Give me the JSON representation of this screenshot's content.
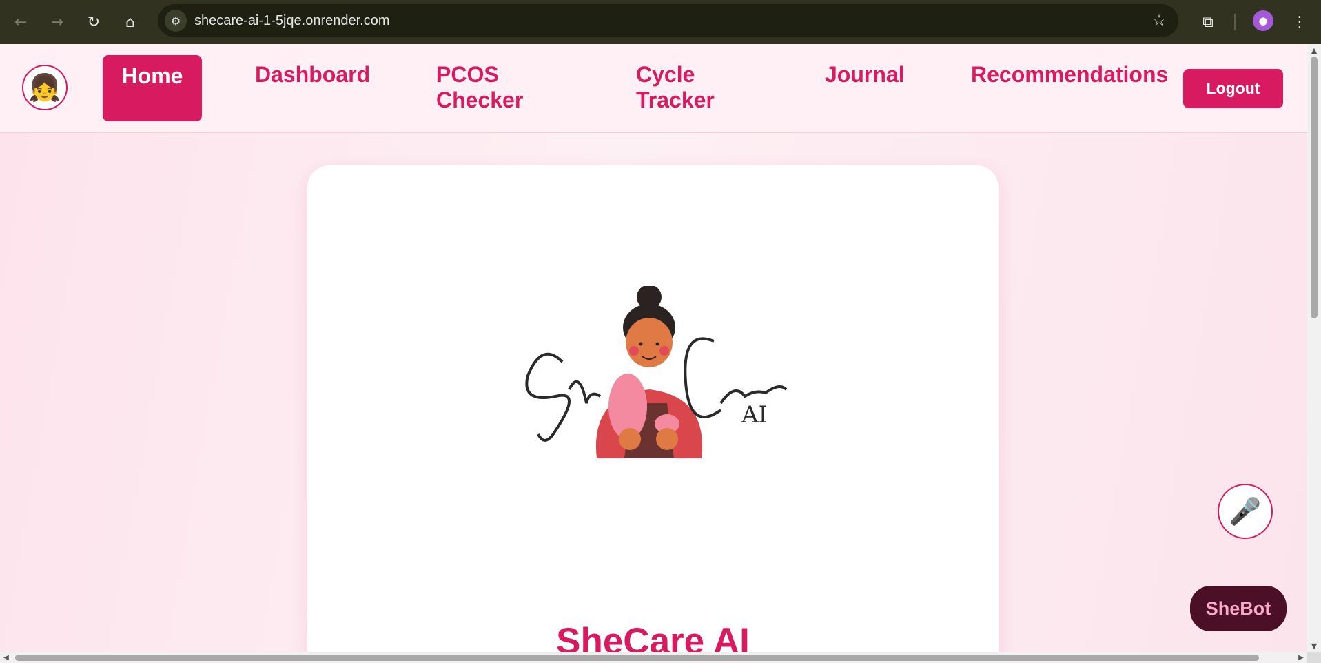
{
  "browser": {
    "url": "shecare-ai-1-5jqe.onrender.com",
    "icons": {
      "back": "arrow-left",
      "forward": "arrow-right",
      "reload": "reload",
      "home": "home",
      "site_settings": "tune",
      "bookmark": "star",
      "extensions": "puzzle",
      "profile": "avatar",
      "menu": "kebab"
    }
  },
  "navbar": {
    "logo_icon": "girl-emoji",
    "links": [
      {
        "label": "Home",
        "active": true
      },
      {
        "label": "Dashboard",
        "active": false
      },
      {
        "label": "PCOS Checker",
        "active": false
      },
      {
        "label": "Cycle Tracker",
        "active": false
      },
      {
        "label": "Journal",
        "active": false
      },
      {
        "label": "Recommendations",
        "active": false
      }
    ],
    "logout_label": "Logout"
  },
  "hero": {
    "logo_script_text": "She Care",
    "logo_sub_text": "AI",
    "title": "SheCare AI"
  },
  "floating": {
    "mic_icon": "microphone",
    "shebot_label": "SheBot"
  },
  "colors": {
    "accent": "#d81b60",
    "chrome_bg": "#31321f",
    "page_bg": "#fde6ee",
    "shebot_bg": "#4b0f26"
  }
}
